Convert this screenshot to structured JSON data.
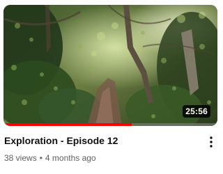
{
  "video": {
    "title": "Exploration - Episode 12",
    "duration": "25:56",
    "views": "38 views",
    "separator": "•",
    "age": "4 months ago",
    "watch_progress_fraction": 0.6,
    "thumbnail_description_icon": "forest-path-thumbnail"
  },
  "menu": {
    "icon": "more-vert-icon"
  },
  "colors": {
    "progress": "#ff0000",
    "title": "#0f0f0f",
    "meta": "#606060"
  }
}
